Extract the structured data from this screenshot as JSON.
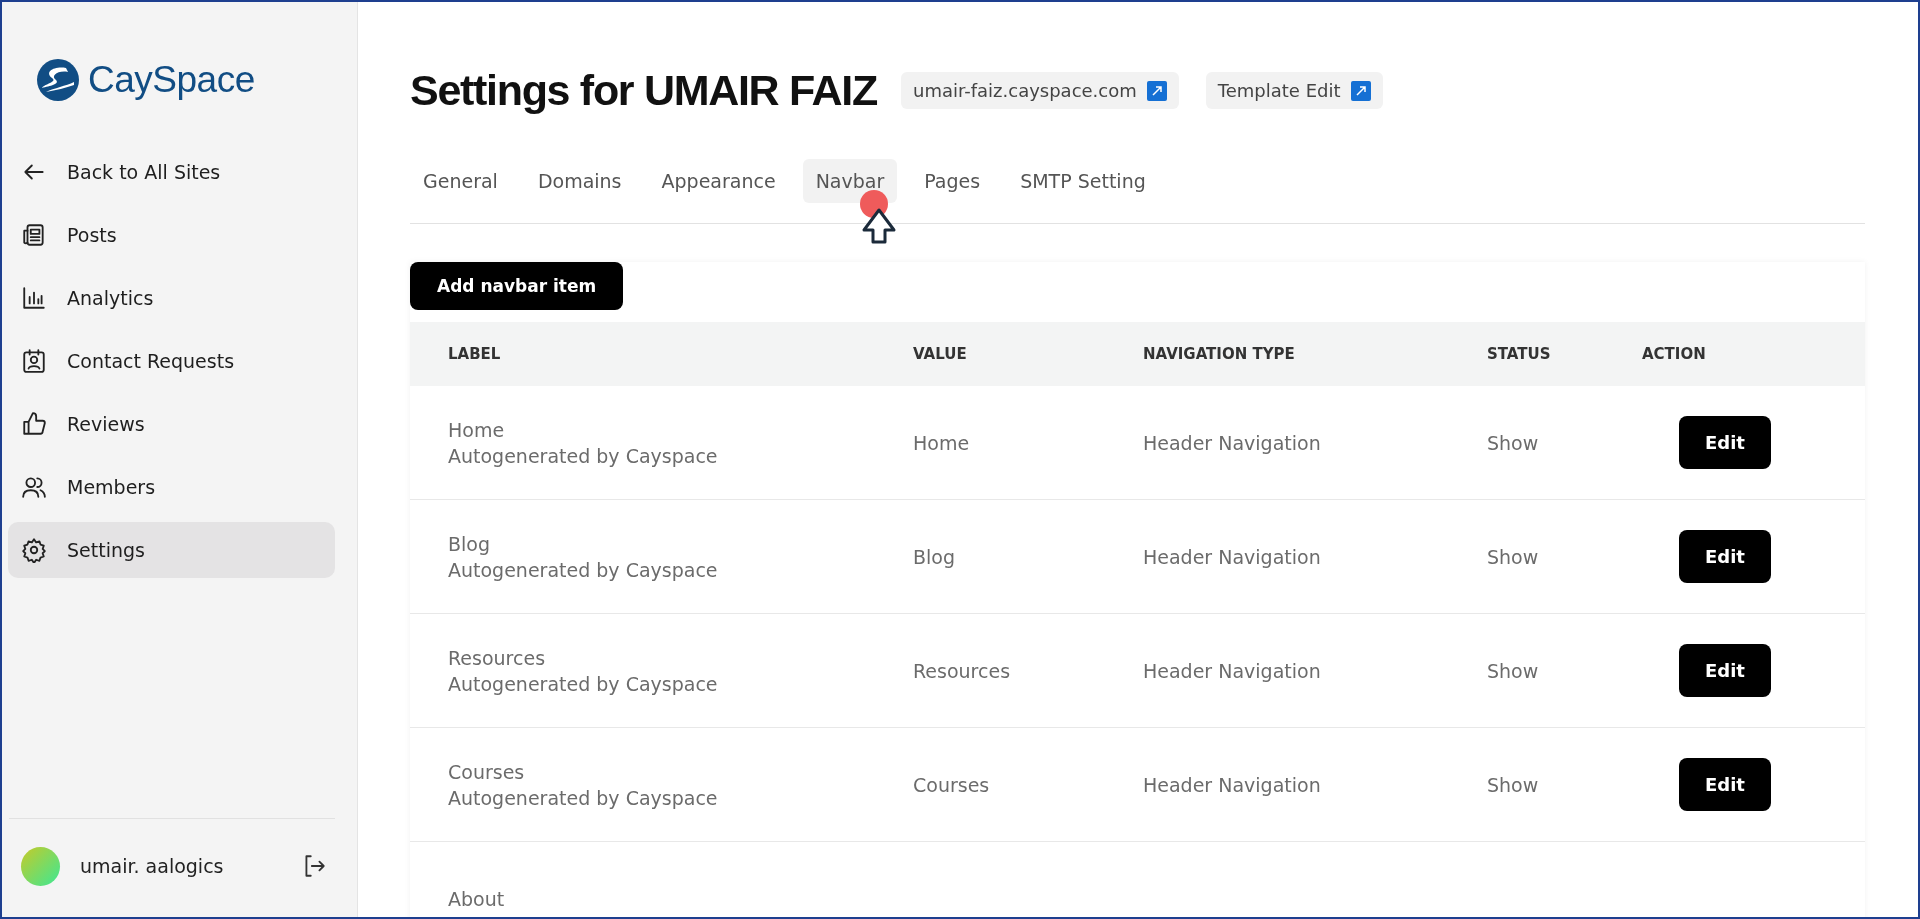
{
  "sidebar": {
    "logo": "CaySpace",
    "items": [
      {
        "kind": "back",
        "label": "Back to All Sites",
        "selected": false
      },
      {
        "kind": "posts",
        "label": "Posts",
        "selected": false
      },
      {
        "kind": "chart",
        "label": "Analytics",
        "selected": false
      },
      {
        "kind": "contact",
        "label": "Contact Requests",
        "selected": false
      },
      {
        "kind": "thumb",
        "label": "Reviews",
        "selected": false
      },
      {
        "kind": "members",
        "label": "Members",
        "selected": false
      },
      {
        "kind": "gear",
        "label": "Settings",
        "selected": true
      }
    ],
    "user": {
      "name": "umair. aalogics"
    }
  },
  "header": {
    "title": "Settings for UMAIR FAIZ",
    "links": [
      "umair-faiz.cayspace.com",
      "Template Edit"
    ]
  },
  "tabs": [
    {
      "label": "General",
      "selected": false
    },
    {
      "label": "Domains",
      "selected": false
    },
    {
      "label": "Appearance",
      "selected": false
    },
    {
      "label": "Navbar",
      "selected": true
    },
    {
      "label": "Pages",
      "selected": false
    },
    {
      "label": "SMTP Setting",
      "selected": false
    }
  ],
  "add_button": "Add navbar item",
  "table": {
    "columns": [
      "LABEL",
      "VALUE",
      "NAVIGATION TYPE",
      "STATUS",
      "ACTION"
    ],
    "rows": [
      {
        "label": "Home",
        "note": "Autogenerated by Cayspace",
        "value": "Home",
        "navigation_type": "Header Navigation",
        "status": "Show",
        "action": "Edit"
      },
      {
        "label": "Blog",
        "note": "Autogenerated by Cayspace",
        "value": "Blog",
        "navigation_type": "Header Navigation",
        "status": "Show",
        "action": "Edit"
      },
      {
        "label": "Resources",
        "note": "Autogenerated by Cayspace",
        "value": "Resources",
        "navigation_type": "Header Navigation",
        "status": "Show",
        "action": "Edit"
      },
      {
        "label": "Courses",
        "note": "Autogenerated by Cayspace",
        "value": "Courses",
        "navigation_type": "Header Navigation",
        "status": "Show",
        "action": "Edit"
      },
      {
        "label": "About"
      }
    ]
  }
}
